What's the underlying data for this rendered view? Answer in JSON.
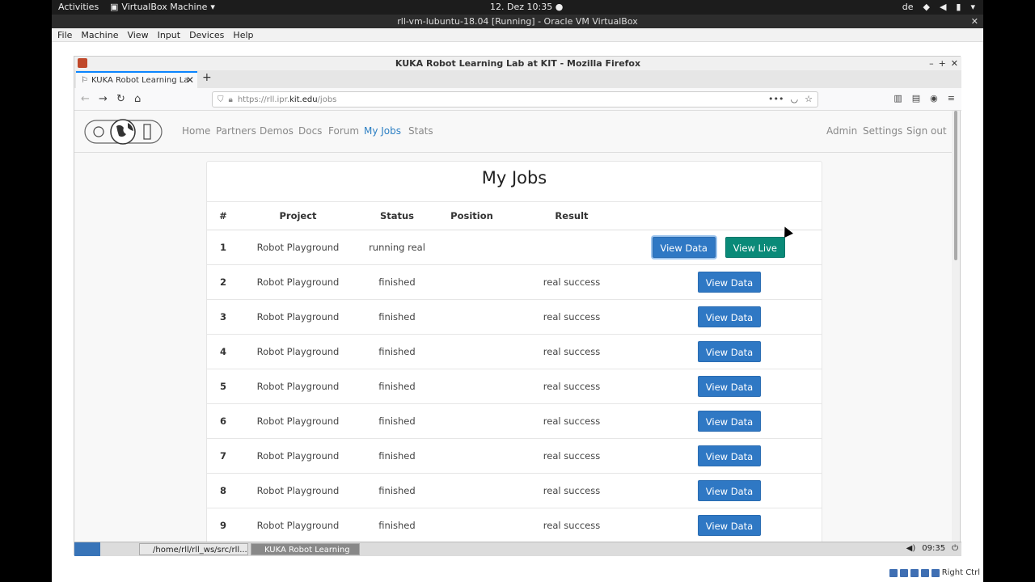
{
  "gnome": {
    "activities": "Activities",
    "app_name": "VirtualBox Machine",
    "clock": "12. Dez 10:35",
    "lang": "de"
  },
  "vbox": {
    "title": "rll-vm-lubuntu-18.04 [Running] - Oracle VM VirtualBox",
    "menu": [
      "File",
      "Machine",
      "View",
      "Input",
      "Devices",
      "Help"
    ],
    "host_key": "Right Ctrl"
  },
  "firefox": {
    "window_title": "KUKA Robot Learning Lab at KIT - Mozilla Firefox",
    "tab_title": "KUKA Robot Learning La",
    "url_scheme": "https://rll.ipr.",
    "url_host": "kit.edu",
    "url_path": "/jobs"
  },
  "site": {
    "nav_left": [
      "Home",
      "Partners",
      "Demos",
      "Docs",
      "Forum",
      "My Jobs",
      "Stats"
    ],
    "nav_right": [
      "Admin",
      "Settings",
      "Sign out"
    ],
    "active": "My Jobs"
  },
  "jobs": {
    "title": "My Jobs",
    "columns": [
      "#",
      "Project",
      "Status",
      "Position",
      "Result"
    ],
    "view_data_label": "View Data",
    "view_live_label": "View Live",
    "rows": [
      {
        "num": "1",
        "project": "Robot Playground",
        "status": "running real",
        "position": "",
        "result": "",
        "live": true
      },
      {
        "num": "2",
        "project": "Robot Playground",
        "status": "finished",
        "position": "",
        "result": "real success",
        "live": false
      },
      {
        "num": "3",
        "project": "Robot Playground",
        "status": "finished",
        "position": "",
        "result": "real success",
        "live": false
      },
      {
        "num": "4",
        "project": "Robot Playground",
        "status": "finished",
        "position": "",
        "result": "real success",
        "live": false
      },
      {
        "num": "5",
        "project": "Robot Playground",
        "status": "finished",
        "position": "",
        "result": "real success",
        "live": false
      },
      {
        "num": "6",
        "project": "Robot Playground",
        "status": "finished",
        "position": "",
        "result": "real success",
        "live": false
      },
      {
        "num": "7",
        "project": "Robot Playground",
        "status": "finished",
        "position": "",
        "result": "real success",
        "live": false
      },
      {
        "num": "8",
        "project": "Robot Playground",
        "status": "finished",
        "position": "",
        "result": "real success",
        "live": false
      },
      {
        "num": "9",
        "project": "Robot Playground",
        "status": "finished",
        "position": "",
        "result": "real success",
        "live": false
      }
    ]
  },
  "lxde": {
    "tasks": [
      "/home/rll/rll_ws/src/rll...",
      "KUKA Robot Learning ..."
    ],
    "clock": "09:35"
  },
  "colors": {
    "primary": "#2f78c4",
    "live": "#0a8a78",
    "nav_active": "#2c7fc3"
  }
}
